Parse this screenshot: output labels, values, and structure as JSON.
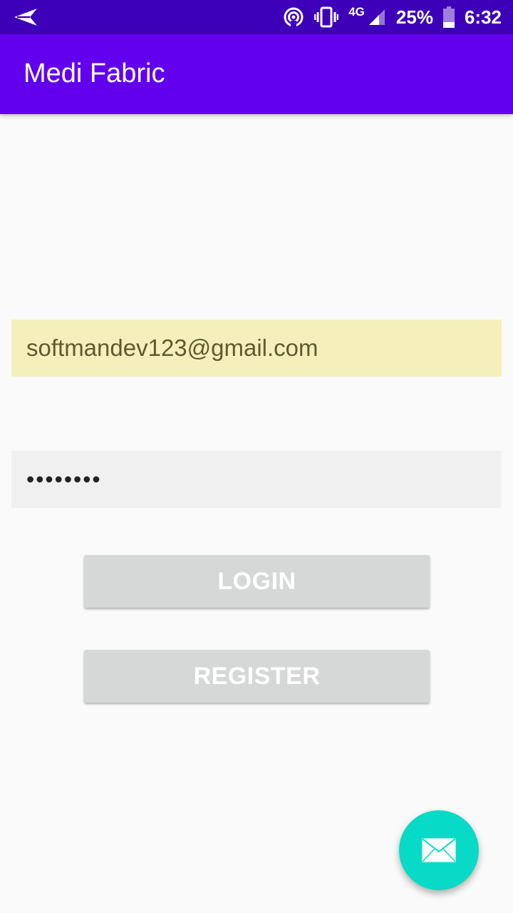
{
  "status_bar": {
    "network_type": "4G",
    "battery_percent": "25%",
    "time": "6:32",
    "icons": [
      "send-icon",
      "hotspot-icon",
      "vibrate-icon",
      "signal-icon",
      "battery-icon"
    ]
  },
  "app_bar": {
    "title": "Medi Fabric"
  },
  "login_form": {
    "email_value": "softmandev123@gmail.com",
    "password_value": "••••••••",
    "login_label": "LOGIN",
    "register_label": "REGISTER"
  },
  "fab": {
    "icon": "email-icon"
  },
  "colors": {
    "status_bar": "#3d00b8",
    "app_bar": "#6200ee",
    "email_field_bg": "#f5f0bb",
    "password_field_bg": "#f0f0f0",
    "button_bg": "#d6d7d7",
    "fab_bg": "#07dac6"
  }
}
